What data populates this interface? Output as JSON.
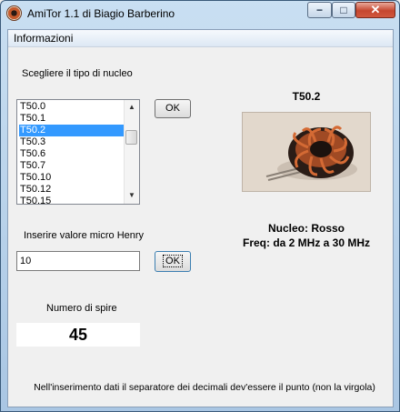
{
  "window": {
    "title": "AmiTor 1.1 di  Biagio Barberino",
    "controls": {
      "minimize": "−",
      "maximize": "□",
      "close": "✕"
    }
  },
  "menu": {
    "items": [
      "Informazioni"
    ]
  },
  "core_select": {
    "label": "Scegliere il tipo di nucleo",
    "items": [
      "T50.0",
      "T50.1",
      "T50.2",
      "T50.3",
      "T50.6",
      "T50.7",
      "T50.10",
      "T50.12",
      "T50.15"
    ],
    "selected": "T50.2",
    "ok_label": "OK"
  },
  "inductance": {
    "label": "Inserire valore micro Henry",
    "value": "10",
    "ok_label": "OK"
  },
  "turns": {
    "label": "Numero di spire",
    "value": "45"
  },
  "core_info": {
    "name": "T50.2",
    "nucleus": "Nucleo: Rosso",
    "frequency": "Freq: da 2 MHz a 30 MHz",
    "image_icon": "toroid-coil-photo"
  },
  "footer_note": "Nell'inserimento dati il separatore dei decimali dev'essere il punto (non la virgola)",
  "colors": {
    "selection": "#3399ff",
    "copper": "#c65a2c"
  }
}
